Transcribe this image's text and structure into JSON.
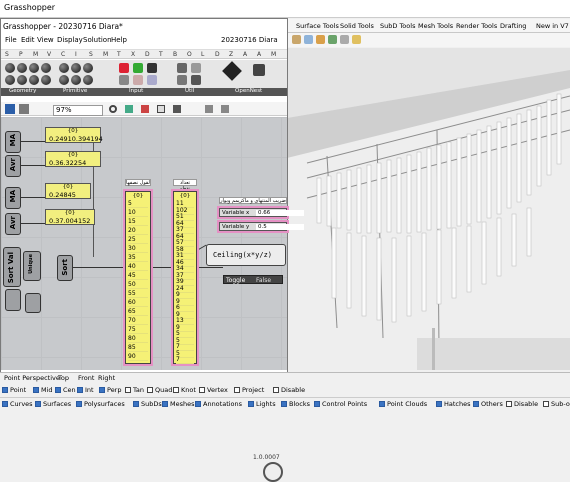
{
  "window_title": "Grasshopper",
  "gh": {
    "title": "Grasshopper - 20230716 Diara*",
    "doc_label": "20230716 Diara",
    "menu": [
      "File",
      "Edit",
      "View",
      "Display",
      "Solution",
      "Help"
    ],
    "ribbon_letters": [
      "S",
      "P",
      "M",
      "V",
      "C",
      "I",
      "S",
      "M",
      "T",
      "X",
      "D",
      "T",
      "B",
      "O",
      "L",
      "D",
      "Z",
      "A",
      "A",
      "M"
    ],
    "groups": [
      "Geometry",
      "Primitive",
      "Input",
      "Util",
      "OpenNest"
    ],
    "zoom": "97%",
    "version": "1.0.0007"
  },
  "panels": [
    {
      "value": "0.24910.394194",
      "hdr": "{0}"
    },
    {
      "value": "0.36.32254",
      "hdr": "{0}"
    },
    {
      "value": "0.24845",
      "hdr": "{0}"
    },
    {
      "value": "0.37.004152",
      "hdr": "{0}"
    }
  ],
  "node_labels": [
    "MA",
    "Avr",
    "MA",
    "Avr",
    "Sort Val",
    "Unique",
    "Sort"
  ],
  "list1": {
    "caption": "لقول نصفها",
    "head": "{0}",
    "rows": [
      "5",
      "10",
      "15",
      "20",
      "25",
      "30",
      "35",
      "40",
      "45",
      "50",
      "55",
      "60",
      "65",
      "70",
      "75",
      "80",
      "85",
      "90"
    ]
  },
  "list2": {
    "caption": "تعداد نقطه مورد نیاز هر دسته",
    "head": "{0}",
    "rows": [
      "11",
      "102",
      "51",
      "64",
      "37",
      "64",
      "57",
      "58",
      "31",
      "46",
      "34",
      "37",
      "39",
      "24",
      "9",
      "9",
      "6",
      "9",
      "13",
      "9",
      "5",
      "5",
      "7",
      "5",
      "7"
    ]
  },
  "sliders_title": "ضریب المنتهای و ماکزیمم ویوار",
  "sliders": [
    {
      "label": "Variable x",
      "value": "0.66"
    },
    {
      "label": "Variable y",
      "value": "0.5"
    }
  ],
  "expression": "Ceiling(x*y/z)",
  "toggle": {
    "label": "Toggle",
    "value": "False"
  },
  "rhino_tabs": [
    "Surface Tools",
    "Solid Tools",
    "SubD Tools",
    "Mesh Tools",
    "Render Tools",
    "Drafting",
    "New in V7"
  ],
  "viewport_tabs": [
    "Point Perspective",
    "Top",
    "Front",
    "Right"
  ],
  "snaps": [
    {
      "label": "Point",
      "on": true
    },
    {
      "label": "Mid",
      "on": true
    },
    {
      "label": "Cen",
      "on": true
    },
    {
      "label": "Int",
      "on": true
    },
    {
      "label": "Perp",
      "on": true
    },
    {
      "label": "Tan",
      "on": false
    },
    {
      "label": "Quad",
      "on": false
    },
    {
      "label": "Knot",
      "on": false
    },
    {
      "label": "Vertex",
      "on": false
    },
    {
      "label": "Project",
      "on": false
    },
    {
      "label": "Disable",
      "on": false
    }
  ],
  "filters": [
    {
      "label": "Curves",
      "on": true
    },
    {
      "label": "Surfaces",
      "on": true
    },
    {
      "label": "Polysurfaces",
      "on": true
    },
    {
      "label": "SubDs",
      "on": true
    },
    {
      "label": "Meshes",
      "on": true
    },
    {
      "label": "Annotations",
      "on": true
    },
    {
      "label": "Lights",
      "on": true
    },
    {
      "label": "Blocks",
      "on": true
    },
    {
      "label": "Control Points",
      "on": true
    },
    {
      "label": "Point Clouds",
      "on": true
    },
    {
      "label": "Hatches",
      "on": true
    },
    {
      "label": "Others",
      "on": true
    },
    {
      "label": "Disable",
      "on": false
    },
    {
      "label": "Sub-objects",
      "on": false
    }
  ],
  "colors": {
    "panel": "#f2ef7f",
    "list": "#f5f176",
    "highlight": "#e591c4",
    "canvas": "#c7c9cc"
  }
}
